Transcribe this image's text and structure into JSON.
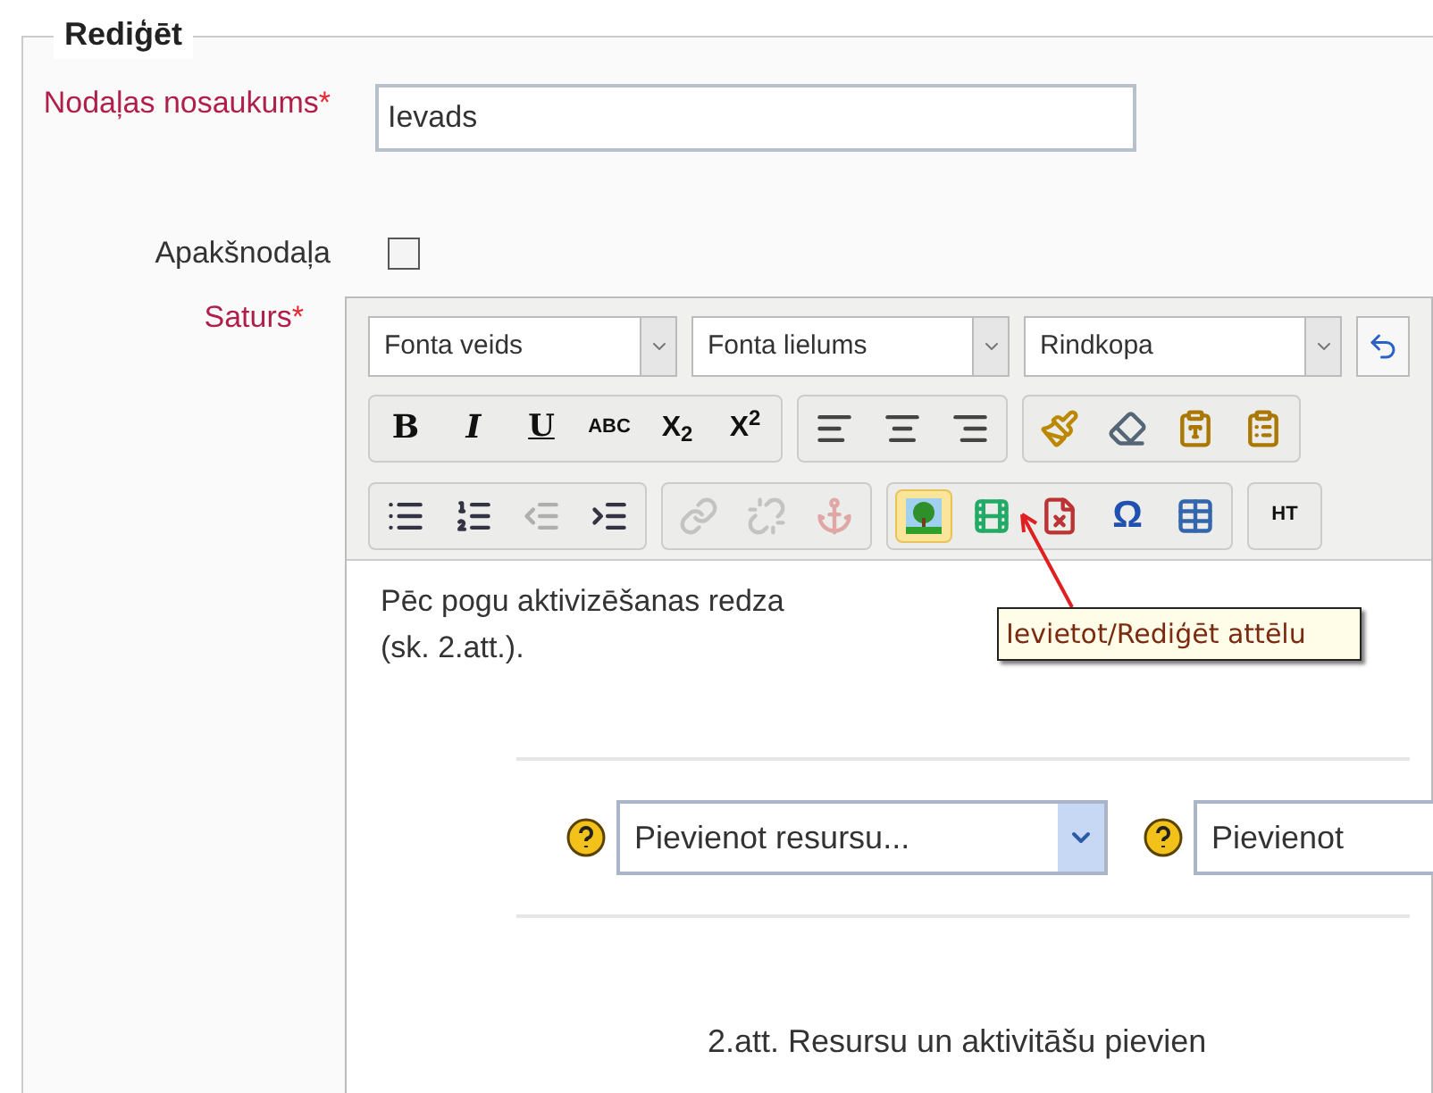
{
  "legend": "Rediģēt",
  "fields": [
    {
      "kind": "text",
      "label": "Nodaļas nosaukums",
      "required_mark": "*",
      "value": "Ievads"
    },
    {
      "kind": "checkbox",
      "label": "Apakšnodaļa",
      "checked": false
    },
    {
      "kind": "editor",
      "label": "Saturs",
      "required_mark": "*"
    }
  ],
  "editor": {
    "selects": [
      "Fonta veids",
      "Fonta lielums",
      "Rindkopa"
    ],
    "toolbar_rows": [
      [
        [
          {
            "kind": "bold",
            "label": "B",
            "disabled": false,
            "highlighted": false
          },
          {
            "kind": "italic",
            "label": "I",
            "disabled": false,
            "highlighted": false
          },
          {
            "kind": "underline",
            "label": "U",
            "disabled": false,
            "highlighted": false
          },
          {
            "kind": "strike",
            "label": "ABC",
            "disabled": false,
            "highlighted": false
          },
          {
            "kind": "sub",
            "label": "X$_{2}$",
            "disabled": false,
            "highlighted": false
          },
          {
            "kind": "sup",
            "label": "X$^{2}$",
            "disabled": false,
            "highlighted": false
          }
        ],
        [
          {
            "kind": "alignleft",
            "disabled": false,
            "highlighted": false
          },
          {
            "kind": "aligncenter",
            "disabled": false,
            "highlighted": false
          },
          {
            "kind": "alignright",
            "disabled": false,
            "highlighted": false
          }
        ],
        [
          {
            "kind": "brush",
            "disabled": false,
            "highlighted": false
          },
          {
            "kind": "eraser",
            "disabled": false,
            "highlighted": false
          },
          {
            "kind": "pastetext",
            "disabled": false,
            "highlighted": false
          },
          {
            "kind": "pasteword",
            "disabled": false,
            "highlighted": false
          }
        ]
      ],
      [
        [
          {
            "kind": "bullets",
            "disabled": false,
            "highlighted": false
          },
          {
            "kind": "numbers",
            "disabled": false,
            "highlighted": false
          },
          {
            "kind": "outdent",
            "disabled": true,
            "highlighted": false
          },
          {
            "kind": "indent",
            "disabled": false,
            "highlighted": false
          }
        ],
        [
          {
            "kind": "link",
            "disabled": true,
            "highlighted": false
          },
          {
            "kind": "unlink",
            "disabled": true,
            "highlighted": false
          },
          {
            "kind": "anchor",
            "disabled": true,
            "highlighted": false
          }
        ],
        [
          {
            "kind": "image",
            "disabled": false,
            "highlighted": true
          },
          {
            "kind": "media",
            "disabled": false,
            "highlighted": false
          },
          {
            "kind": "nbsp",
            "disabled": false,
            "highlighted": false
          },
          {
            "kind": "omega",
            "label": "Ω",
            "disabled": false,
            "highlighted": false
          },
          {
            "kind": "table",
            "disabled": false,
            "highlighted": false
          }
        ],
        [
          {
            "kind": "html",
            "label": "HT",
            "disabled": false,
            "highlighted": false
          }
        ]
      ]
    ],
    "paragraph_lines": [
      "Pēc pogu aktivizēšanas redza",
      "(sk. 2.att.)."
    ],
    "tooltip": "Ievietot/Rediģēt attēlu",
    "figure": {
      "selects": [
        "Pievienot resursu...",
        "Pievienot"
      ],
      "caption": "2.att. Resursu un aktivitāšu pievien"
    }
  }
}
